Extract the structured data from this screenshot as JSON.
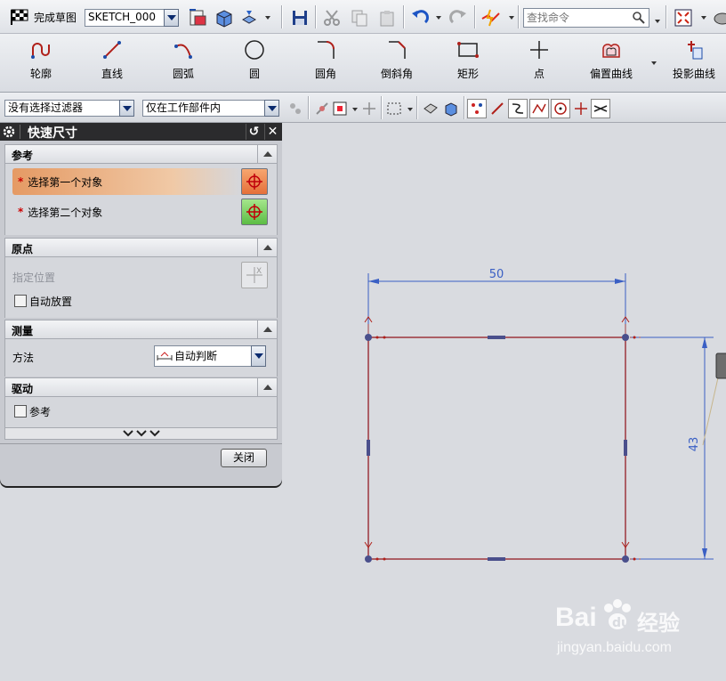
{
  "toolbar": {
    "finish_sketch_label": "完成草图",
    "sketch_name": "SKETCH_000",
    "search_placeholder": "查找命令"
  },
  "curve_tools": [
    {
      "label": "轮廓",
      "icon": "profile-icon"
    },
    {
      "label": "直线",
      "icon": "line-icon"
    },
    {
      "label": "圆弧",
      "icon": "arc-icon"
    },
    {
      "label": "圆",
      "icon": "circle-icon"
    },
    {
      "label": "圆角",
      "icon": "fillet-icon"
    },
    {
      "label": "倒斜角",
      "icon": "chamfer-icon"
    },
    {
      "label": "矩形",
      "icon": "rectangle-icon"
    },
    {
      "label": "点",
      "icon": "point-icon"
    },
    {
      "label": "偏置曲线",
      "icon": "offset-curve-icon"
    },
    {
      "label": "投影曲线",
      "icon": "project-curve-icon"
    }
  ],
  "filters": {
    "selection_filter": "没有选择过滤器",
    "scope": "仅在工作部件内"
  },
  "dialog": {
    "title": "快速尺寸",
    "reference": {
      "title": "参考",
      "first_object": "选择第一个对象",
      "second_object": "选择第二个对象"
    },
    "origin": {
      "title": "原点",
      "specify_location": "指定位置",
      "auto_place": "自动放置"
    },
    "measurement": {
      "title": "测量",
      "method_label": "方法",
      "method_value": "自动判断"
    },
    "driving": {
      "title": "驱动",
      "reference": "参考"
    },
    "close_button": "关闭"
  },
  "sketch": {
    "width_dimension": "50",
    "height_dimension": "43"
  },
  "watermark": {
    "brand": "Bai",
    "brand_suffix": "经验",
    "url": "jingyan.baidu.com"
  },
  "colors": {
    "sketch_line": "#a04048",
    "dimension": "#3a5fc4",
    "active_select": "#e59a64"
  }
}
